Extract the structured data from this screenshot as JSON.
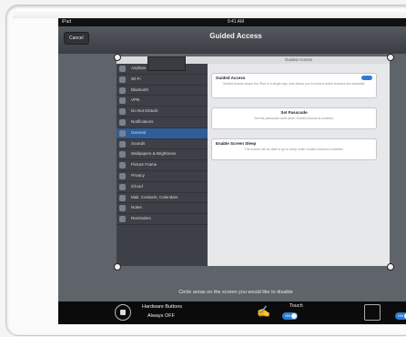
{
  "status_bar": {
    "left": "iPad",
    "time": "9:41 AM"
  },
  "nav": {
    "cancel_label": "Cancel",
    "title": "Guided Access"
  },
  "settings_left": {
    "header": "Settings",
    "items": [
      "Airplane Mode",
      "Wi-Fi",
      "Bluetooth",
      "VPN",
      "Do Not Disturb",
      "Notifications",
      "General",
      "Sounds",
      "Wallpapers & Brightness",
      "Picture Frame",
      "Privacy",
      "iCloud",
      "Mail, Contacts, Calendars",
      "Notes",
      "Reminders"
    ],
    "selected_index": 6
  },
  "settings_right": {
    "header": "Guided Access",
    "guided_access_title": "Guided Access",
    "guided_access_desc": "Guided Access keeps the iPad in a single app, and allows you to control which features are available.",
    "set_passcode_title": "Set Passcode",
    "set_passcode_desc": "Set the passcode used when Guided Access is enabled.",
    "enable_sleep_title": "Enable Screen Sleep",
    "enable_sleep_desc": "The screen will be able to go to sleep while Guided Access is enabled."
  },
  "hint": "Circle areas on the screen you would like to disable",
  "toolbar": {
    "hardware_label": "Hardware Buttons",
    "hardware_value": "Always OFF",
    "touch_label": "Touch",
    "touch_toggle": "ON",
    "motion_toggle": "ON"
  },
  "colors": {
    "accent_blue": "#2c7cd6",
    "toolbar_bg": "#0b0b0b",
    "screen_dim": "#5f646b"
  }
}
